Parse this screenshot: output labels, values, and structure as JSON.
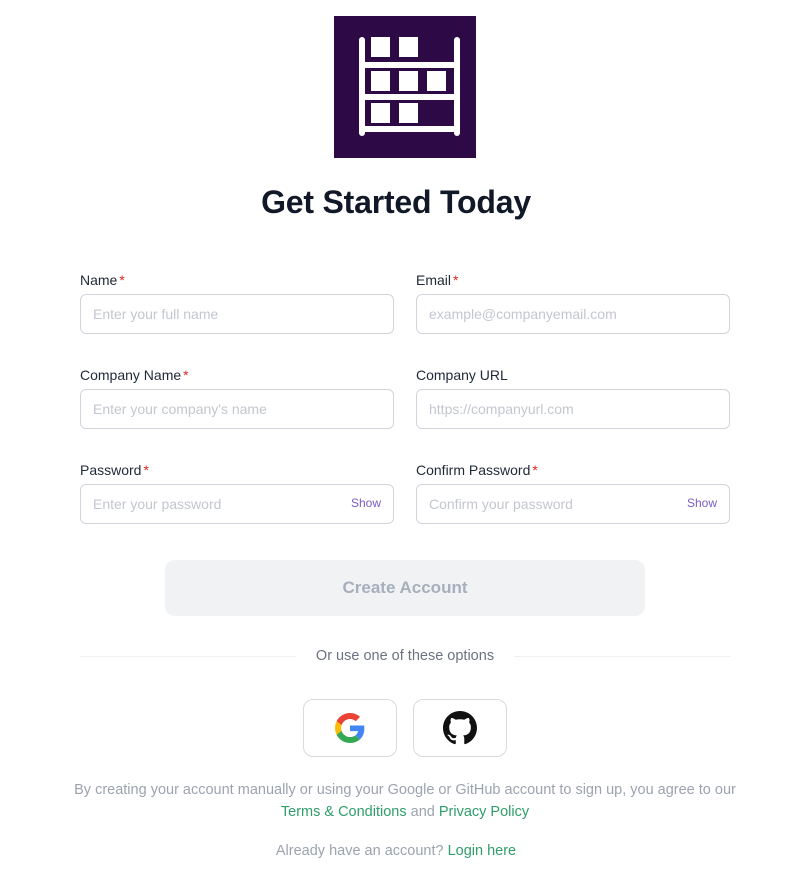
{
  "brand": {
    "logo_icon": "shelving-icon",
    "logo_bg": "#2d0a45"
  },
  "header": {
    "title": "Get Started Today"
  },
  "form": {
    "required_marker": "*",
    "fields": {
      "name": {
        "label": "Name",
        "placeholder": "Enter your full name",
        "value": "",
        "required": true
      },
      "email": {
        "label": "Email",
        "placeholder": "example@companyemail.com",
        "value": "",
        "required": true
      },
      "company_name": {
        "label": "Company Name",
        "placeholder": "Enter your company's name",
        "value": "",
        "required": true
      },
      "company_url": {
        "label": "Company URL",
        "placeholder": "https://companyurl.com",
        "value": "",
        "required": false
      },
      "password": {
        "label": "Password",
        "placeholder": "Enter your password",
        "value": "",
        "required": true,
        "toggle_label": "Show"
      },
      "confirm_password": {
        "label": "Confirm Password",
        "placeholder": "Confirm your password",
        "value": "",
        "required": true,
        "toggle_label": "Show"
      }
    },
    "submit_label": "Create Account"
  },
  "alt_signup": {
    "divider_text": "Or use one of these options",
    "providers": [
      {
        "name": "Google",
        "icon": "google-icon"
      },
      {
        "name": "GitHub",
        "icon": "github-icon"
      }
    ]
  },
  "legal": {
    "prefix": "By creating your account manually or using your Google or GitHub account to sign up, you agree to our",
    "terms_link": "Terms & Conditions",
    "conjunction": "and",
    "privacy_link": "Privacy Policy"
  },
  "login": {
    "prompt": "Already have an account?",
    "link": "Login here"
  },
  "colors": {
    "link": "#2f9e6a",
    "show_toggle": "#7c5cc4",
    "required": "#dc2626"
  }
}
